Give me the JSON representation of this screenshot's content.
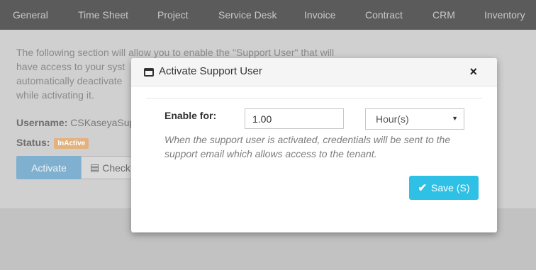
{
  "nav": {
    "items": [
      "General",
      "Time Sheet",
      "Project",
      "Service Desk",
      "Invoice",
      "Contract",
      "CRM",
      "Inventory"
    ]
  },
  "page": {
    "description": "The following section will allow you to enable the \"Support User\" that will have access to your syst automatically deactivate while activating it.",
    "desc_lines": [
      "The following section will allow you to enable the \"Support User\" that will",
      "have access to your syst",
      "automatically deactivate",
      "while activating it."
    ],
    "username_label": "Username:",
    "username_value": "CSKaseyaSup",
    "status_label": "Status:",
    "status_badge": "InActive",
    "activate_label": "Activate",
    "check_label": "Check"
  },
  "modal": {
    "title": "Activate Support User",
    "close": "×",
    "enable_label": "Enable for:",
    "enable_value": "1.00",
    "unit_selected": "Hour(s)",
    "help": "When the support user is activated, credentials will be sent to the support email which allows access to the tenant.",
    "save_label": "Save (S)"
  },
  "colors": {
    "nav_bg": "#5b5b5b",
    "save_button": "#2fc0e6",
    "badge": "#e3b27f"
  },
  "icons": {
    "window": "window-icon",
    "close": "close-icon",
    "save": "check-icon",
    "check": "list-icon",
    "caret": "caret-down-icon"
  }
}
